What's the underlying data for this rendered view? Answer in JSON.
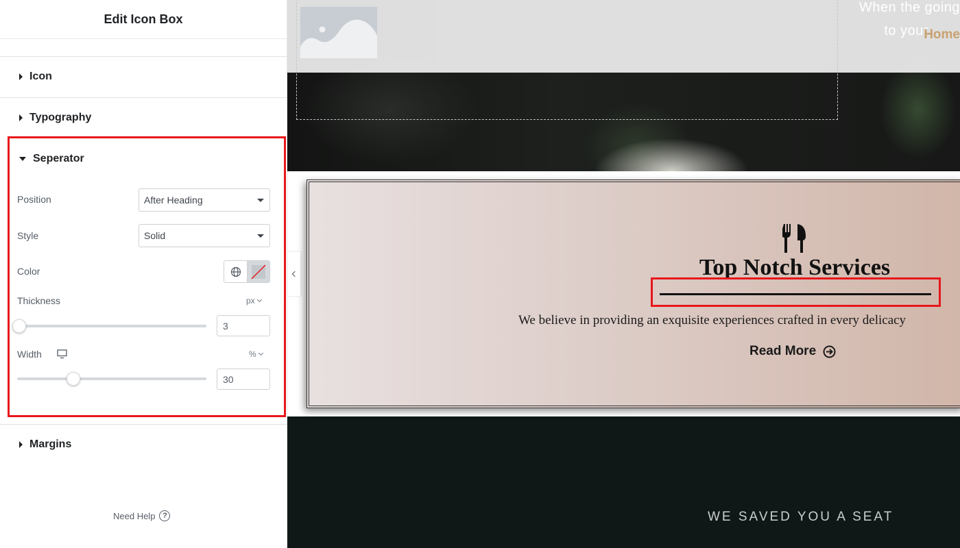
{
  "panel": {
    "title": "Edit Icon Box",
    "sections": {
      "icon": "Icon",
      "typography": "Typography",
      "separator": "Seperator",
      "margins": "Margins"
    },
    "separator": {
      "position_label": "Position",
      "position_value": "After Heading",
      "style_label": "Style",
      "style_value": "Solid",
      "color_label": "Color",
      "thickness_label": "Thickness",
      "thickness_unit": "px",
      "thickness_value": "3",
      "width_label": "Width",
      "width_unit": "%",
      "width_value": "30"
    },
    "need_help": "Need Help",
    "help_glyph": "?"
  },
  "preview": {
    "hero_line1": "When the going",
    "hero_line2": "to your",
    "home_link": "Home",
    "card_title": "Top Notch Services",
    "card_description": "We believe in providing an exquisite experiences crafted in every delicacy",
    "read_more": "Read More",
    "seat_text": "WE SAVED YOU A SEAT"
  },
  "colors": {
    "highlight": "#e8161b",
    "accent_link": "#c8a070",
    "dark_section": "#101817"
  },
  "icons": [
    "globe-icon",
    "no-color-swatch-icon",
    "desktop-icon",
    "help-icon",
    "fork-knife-icon",
    "arrow-circle-right-icon",
    "chevron-left-icon",
    "image-placeholder-icon"
  ]
}
